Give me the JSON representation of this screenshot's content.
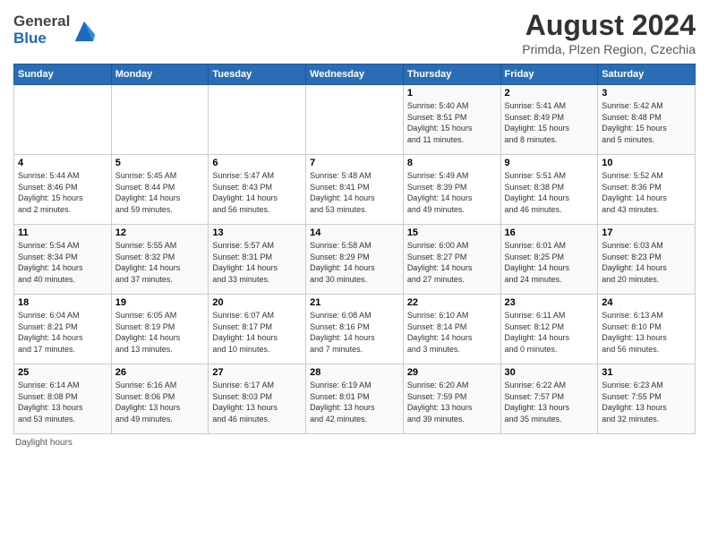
{
  "header": {
    "logo_general": "General",
    "logo_blue": "Blue",
    "title": "August 2024",
    "subtitle": "Primda, Plzen Region, Czechia"
  },
  "calendar": {
    "weekdays": [
      "Sunday",
      "Monday",
      "Tuesday",
      "Wednesday",
      "Thursday",
      "Friday",
      "Saturday"
    ],
    "weeks": [
      [
        {
          "day": "",
          "info": ""
        },
        {
          "day": "",
          "info": ""
        },
        {
          "day": "",
          "info": ""
        },
        {
          "day": "",
          "info": ""
        },
        {
          "day": "1",
          "info": "Sunrise: 5:40 AM\nSunset: 8:51 PM\nDaylight: 15 hours\nand 11 minutes."
        },
        {
          "day": "2",
          "info": "Sunrise: 5:41 AM\nSunset: 8:49 PM\nDaylight: 15 hours\nand 8 minutes."
        },
        {
          "day": "3",
          "info": "Sunrise: 5:42 AM\nSunset: 8:48 PM\nDaylight: 15 hours\nand 5 minutes."
        }
      ],
      [
        {
          "day": "4",
          "info": "Sunrise: 5:44 AM\nSunset: 8:46 PM\nDaylight: 15 hours\nand 2 minutes."
        },
        {
          "day": "5",
          "info": "Sunrise: 5:45 AM\nSunset: 8:44 PM\nDaylight: 14 hours\nand 59 minutes."
        },
        {
          "day": "6",
          "info": "Sunrise: 5:47 AM\nSunset: 8:43 PM\nDaylight: 14 hours\nand 56 minutes."
        },
        {
          "day": "7",
          "info": "Sunrise: 5:48 AM\nSunset: 8:41 PM\nDaylight: 14 hours\nand 53 minutes."
        },
        {
          "day": "8",
          "info": "Sunrise: 5:49 AM\nSunset: 8:39 PM\nDaylight: 14 hours\nand 49 minutes."
        },
        {
          "day": "9",
          "info": "Sunrise: 5:51 AM\nSunset: 8:38 PM\nDaylight: 14 hours\nand 46 minutes."
        },
        {
          "day": "10",
          "info": "Sunrise: 5:52 AM\nSunset: 8:36 PM\nDaylight: 14 hours\nand 43 minutes."
        }
      ],
      [
        {
          "day": "11",
          "info": "Sunrise: 5:54 AM\nSunset: 8:34 PM\nDaylight: 14 hours\nand 40 minutes."
        },
        {
          "day": "12",
          "info": "Sunrise: 5:55 AM\nSunset: 8:32 PM\nDaylight: 14 hours\nand 37 minutes."
        },
        {
          "day": "13",
          "info": "Sunrise: 5:57 AM\nSunset: 8:31 PM\nDaylight: 14 hours\nand 33 minutes."
        },
        {
          "day": "14",
          "info": "Sunrise: 5:58 AM\nSunset: 8:29 PM\nDaylight: 14 hours\nand 30 minutes."
        },
        {
          "day": "15",
          "info": "Sunrise: 6:00 AM\nSunset: 8:27 PM\nDaylight: 14 hours\nand 27 minutes."
        },
        {
          "day": "16",
          "info": "Sunrise: 6:01 AM\nSunset: 8:25 PM\nDaylight: 14 hours\nand 24 minutes."
        },
        {
          "day": "17",
          "info": "Sunrise: 6:03 AM\nSunset: 8:23 PM\nDaylight: 14 hours\nand 20 minutes."
        }
      ],
      [
        {
          "day": "18",
          "info": "Sunrise: 6:04 AM\nSunset: 8:21 PM\nDaylight: 14 hours\nand 17 minutes."
        },
        {
          "day": "19",
          "info": "Sunrise: 6:05 AM\nSunset: 8:19 PM\nDaylight: 14 hours\nand 13 minutes."
        },
        {
          "day": "20",
          "info": "Sunrise: 6:07 AM\nSunset: 8:17 PM\nDaylight: 14 hours\nand 10 minutes."
        },
        {
          "day": "21",
          "info": "Sunrise: 6:08 AM\nSunset: 8:16 PM\nDaylight: 14 hours\nand 7 minutes."
        },
        {
          "day": "22",
          "info": "Sunrise: 6:10 AM\nSunset: 8:14 PM\nDaylight: 14 hours\nand 3 minutes."
        },
        {
          "day": "23",
          "info": "Sunrise: 6:11 AM\nSunset: 8:12 PM\nDaylight: 14 hours\nand 0 minutes."
        },
        {
          "day": "24",
          "info": "Sunrise: 6:13 AM\nSunset: 8:10 PM\nDaylight: 13 hours\nand 56 minutes."
        }
      ],
      [
        {
          "day": "25",
          "info": "Sunrise: 6:14 AM\nSunset: 8:08 PM\nDaylight: 13 hours\nand 53 minutes."
        },
        {
          "day": "26",
          "info": "Sunrise: 6:16 AM\nSunset: 8:06 PM\nDaylight: 13 hours\nand 49 minutes."
        },
        {
          "day": "27",
          "info": "Sunrise: 6:17 AM\nSunset: 8:03 PM\nDaylight: 13 hours\nand 46 minutes."
        },
        {
          "day": "28",
          "info": "Sunrise: 6:19 AM\nSunset: 8:01 PM\nDaylight: 13 hours\nand 42 minutes."
        },
        {
          "day": "29",
          "info": "Sunrise: 6:20 AM\nSunset: 7:59 PM\nDaylight: 13 hours\nand 39 minutes."
        },
        {
          "day": "30",
          "info": "Sunrise: 6:22 AM\nSunset: 7:57 PM\nDaylight: 13 hours\nand 35 minutes."
        },
        {
          "day": "31",
          "info": "Sunrise: 6:23 AM\nSunset: 7:55 PM\nDaylight: 13 hours\nand 32 minutes."
        }
      ]
    ]
  },
  "footer": {
    "note": "Daylight hours"
  }
}
